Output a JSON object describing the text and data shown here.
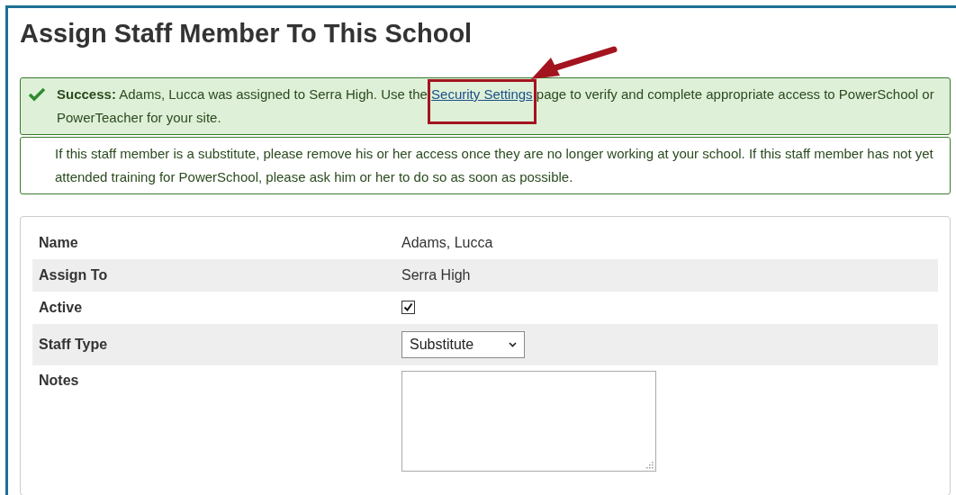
{
  "title": "Assign Staff Member To This School",
  "success": {
    "before": "**Success:** Adams, Lucca was assigned to Serra High. Use the",
    "link": "Security Settings",
    "after": "page to verify and complete appropriate access to PowerSchool or PowerTeacher for your site."
  },
  "notice": "If this staff member is a substitute, please remove his or her access once they are no longer working at your school. If this staff member has not yet attended training for PowerSchool, please ask him or her to do so as soon as possible.",
  "fields": [
    {
      "label": "Name",
      "kind": "text",
      "value": "Adams, Lucca"
    },
    {
      "label": "Assign To",
      "kind": "text",
      "value": "Serra High"
    },
    {
      "label": "Active",
      "kind": "checkbox",
      "checked": true
    },
    {
      "label": "Staff Type",
      "kind": "select",
      "value": "Substitute"
    },
    {
      "label": "Notes",
      "kind": "textarea"
    }
  ]
}
